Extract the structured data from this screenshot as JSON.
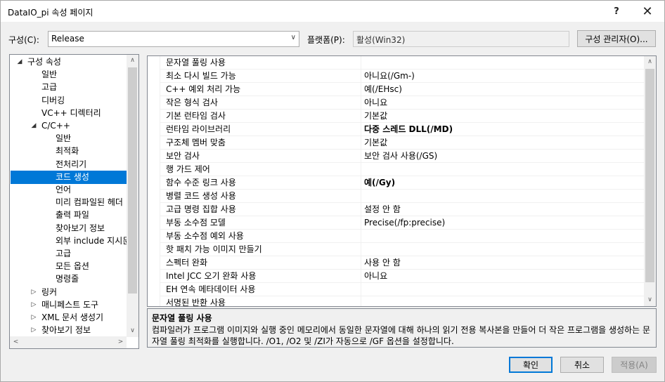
{
  "window": {
    "title": "DataIO_pi 속성 페이지",
    "help_glyph": "?",
    "close_glyph": "✕"
  },
  "config": {
    "label": "구성(C):",
    "value": "Release",
    "platform_label": "플랫폼(P):",
    "platform_value": "활성(Win32)",
    "manager_button": "구성 관리자(O)..."
  },
  "tree": {
    "items": [
      {
        "label": "구성 속성",
        "toggle": "◢",
        "level": 0
      },
      {
        "label": "일반",
        "toggle": "",
        "level": 1
      },
      {
        "label": "고급",
        "toggle": "",
        "level": 1
      },
      {
        "label": "디버깅",
        "toggle": "",
        "level": 1
      },
      {
        "label": "VC++ 디렉터리",
        "toggle": "",
        "level": 1
      },
      {
        "label": "C/C++",
        "toggle": "◢",
        "level": 1
      },
      {
        "label": "일반",
        "toggle": "",
        "level": 2
      },
      {
        "label": "최적화",
        "toggle": "",
        "level": 2
      },
      {
        "label": "전처리기",
        "toggle": "",
        "level": 2
      },
      {
        "label": "코드 생성",
        "toggle": "",
        "level": 2,
        "selected": true
      },
      {
        "label": "언어",
        "toggle": "",
        "level": 2
      },
      {
        "label": "미리 컴파일된 헤더",
        "toggle": "",
        "level": 2
      },
      {
        "label": "출력 파일",
        "toggle": "",
        "level": 2
      },
      {
        "label": "찾아보기 정보",
        "toggle": "",
        "level": 2
      },
      {
        "label": "외부 include 지시문",
        "toggle": "",
        "level": 2
      },
      {
        "label": "고급",
        "toggle": "",
        "level": 2
      },
      {
        "label": "모든 옵션",
        "toggle": "",
        "level": 2
      },
      {
        "label": "명령줄",
        "toggle": "",
        "level": 2
      },
      {
        "label": "링커",
        "toggle": "▷",
        "level": 1
      },
      {
        "label": "매니페스트 도구",
        "toggle": "▷",
        "level": 1
      },
      {
        "label": "XML 문서 생성기",
        "toggle": "▷",
        "level": 1
      },
      {
        "label": "찾아보기 정보",
        "toggle": "▷",
        "level": 1
      }
    ]
  },
  "properties": [
    {
      "name": "문자열 풀링 사용",
      "value": "",
      "bold": false
    },
    {
      "name": "최소 다시 빌드 가능",
      "value": "아니요(/Gm-)",
      "bold": false
    },
    {
      "name": "C++ 예외 처리 가능",
      "value": "예(/EHsc)",
      "bold": false
    },
    {
      "name": "작은 형식 검사",
      "value": "아니요",
      "bold": false
    },
    {
      "name": "기본 런타임 검사",
      "value": "기본값",
      "bold": false
    },
    {
      "name": "런타임 라이브러리",
      "value": "다중 스레드 DLL(/MD)",
      "bold": true
    },
    {
      "name": "구조체 멤버 맞춤",
      "value": "기본값",
      "bold": false
    },
    {
      "name": "보안 검사",
      "value": "보안 검사 사용(/GS)",
      "bold": false
    },
    {
      "name": "행 가드 제어",
      "value": "",
      "bold": false
    },
    {
      "name": "함수 수준 링크 사용",
      "value": "예(/Gy)",
      "bold": true
    },
    {
      "name": "병렬 코드 생성 사용",
      "value": "",
      "bold": false
    },
    {
      "name": "고급 명령 집합 사용",
      "value": "설정 안 함",
      "bold": false
    },
    {
      "name": "부동 소수점 모델",
      "value": "Precise(/fp:precise)",
      "bold": false
    },
    {
      "name": "부동 소수점 예외 사용",
      "value": "",
      "bold": false
    },
    {
      "name": "핫 패치 가능 이미지 만들기",
      "value": "",
      "bold": false
    },
    {
      "name": "스펙터 완화",
      "value": "사용 안 함",
      "bold": false
    },
    {
      "name": "Intel JCC 오기 완화 사용",
      "value": "아니요",
      "bold": false
    },
    {
      "name": "EH 연속 메타데이터 사용",
      "value": "",
      "bold": false
    },
    {
      "name": "서명된 반환 사용",
      "value": "",
      "bold": false
    }
  ],
  "description": {
    "title": "문자열 풀링 사용",
    "text": "컴파일러가 프로그램 이미지와 실행 중인 메모리에서 동일한 문자열에 대해 하나의 읽기 전용 복사본을 만들어 더 작은 프로그램을 생성하는 문자열 풀링 최적화를 실행합니다. /O1, /O2 및 /ZI가 자동으로 /GF 옵션을 설정합니다."
  },
  "buttons": {
    "ok": "확인",
    "cancel": "취소",
    "apply": "적용(A)"
  }
}
